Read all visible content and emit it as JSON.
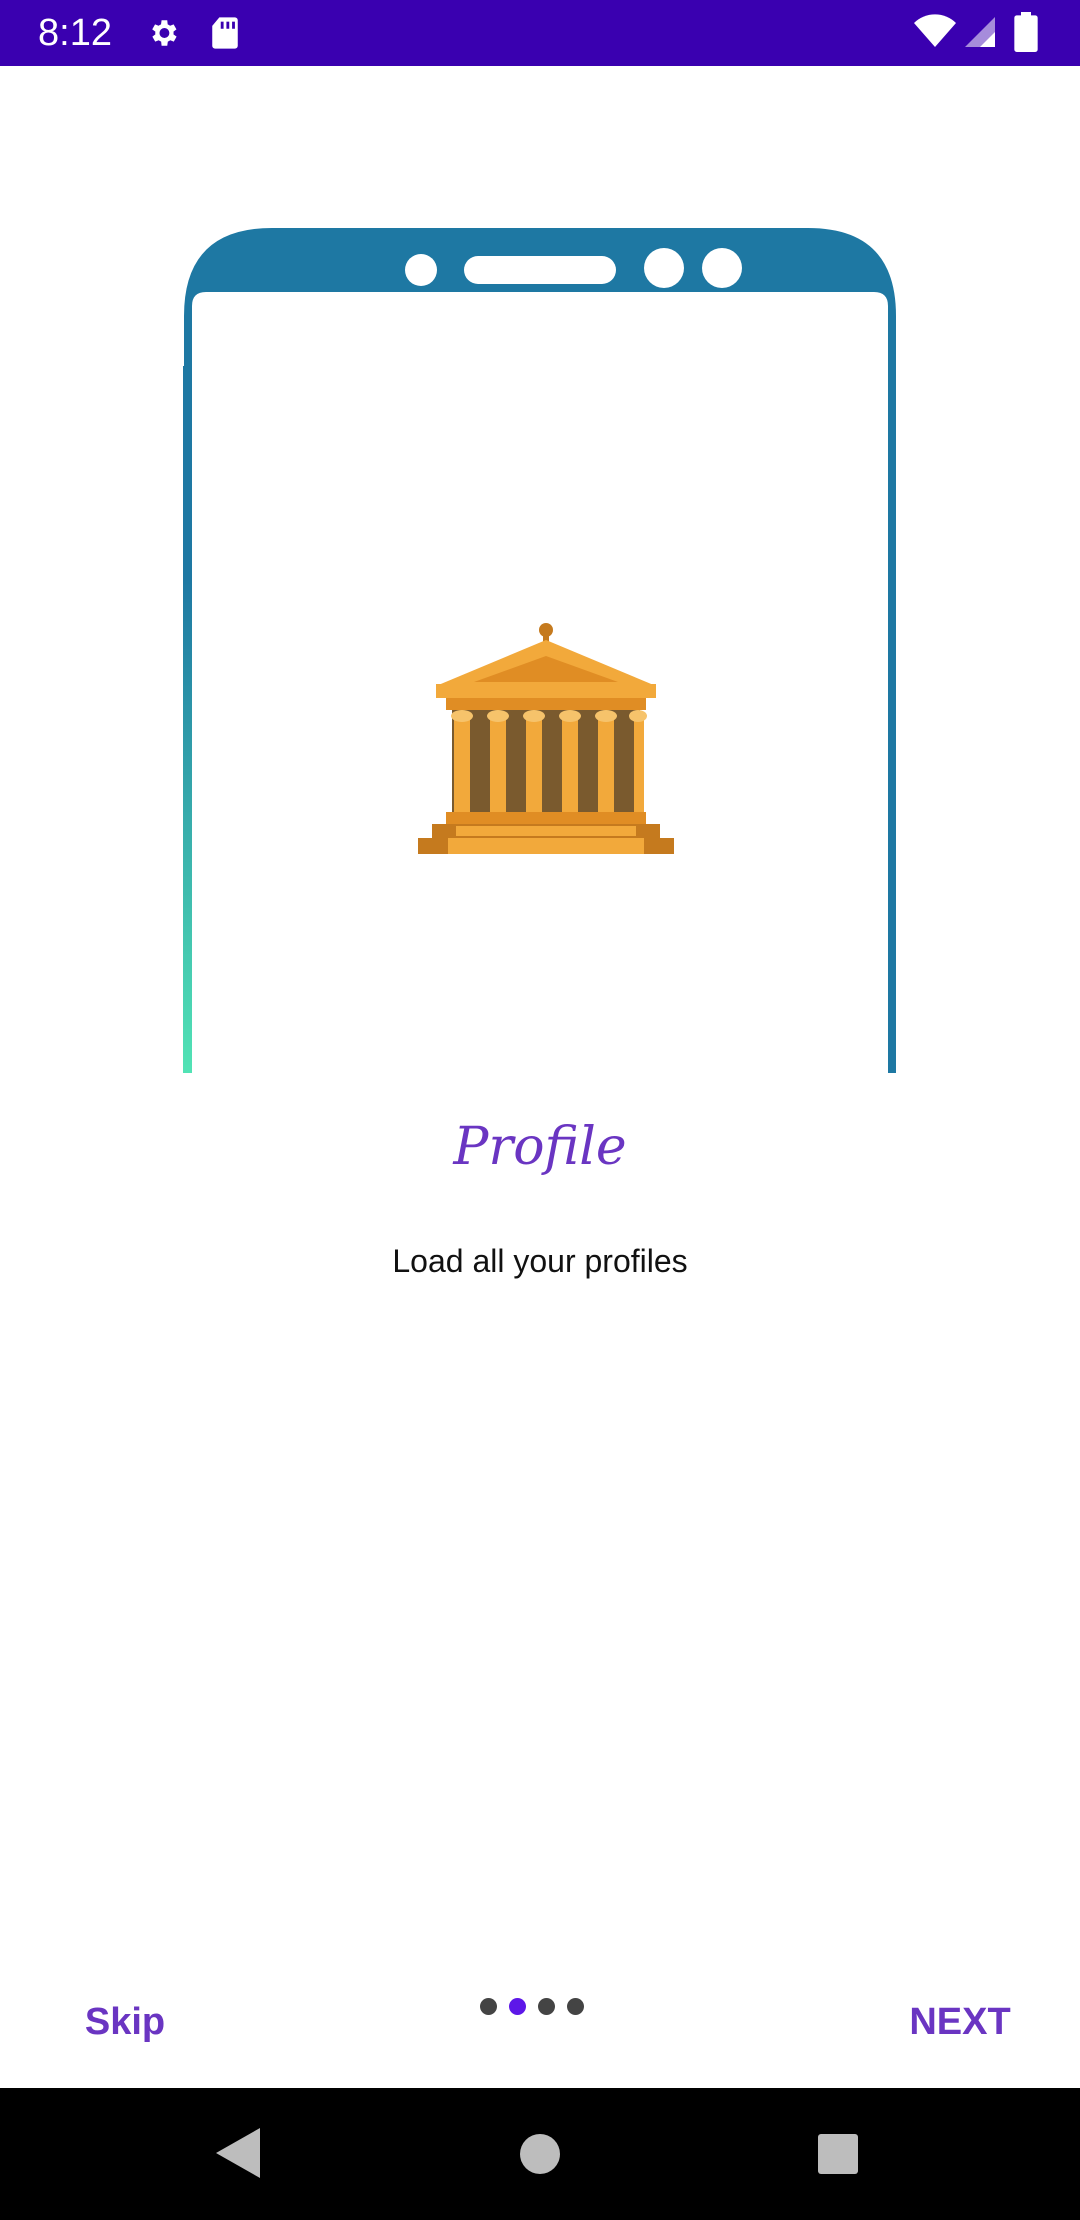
{
  "status_bar": {
    "time": "8:12",
    "icons": [
      "settings-gear-icon",
      "sd-card-icon",
      "wifi-icon",
      "signal-icon",
      "battery-icon"
    ],
    "color": "#3a00b0"
  },
  "onboarding": {
    "title": "Profile",
    "subtitle": "Load all your profiles",
    "page_indicator": {
      "total": 4,
      "current": 2
    },
    "skip_label": "Skip",
    "next_label": "NEXT",
    "accent_color": "#6a35c2"
  },
  "illustration": {
    "icon": "bank-building-icon",
    "frame_color": "#1e78a3",
    "accent_gradient": "#52e3b5"
  },
  "nav_bar": {
    "buttons": [
      "back-icon",
      "home-icon",
      "recents-icon"
    ]
  }
}
